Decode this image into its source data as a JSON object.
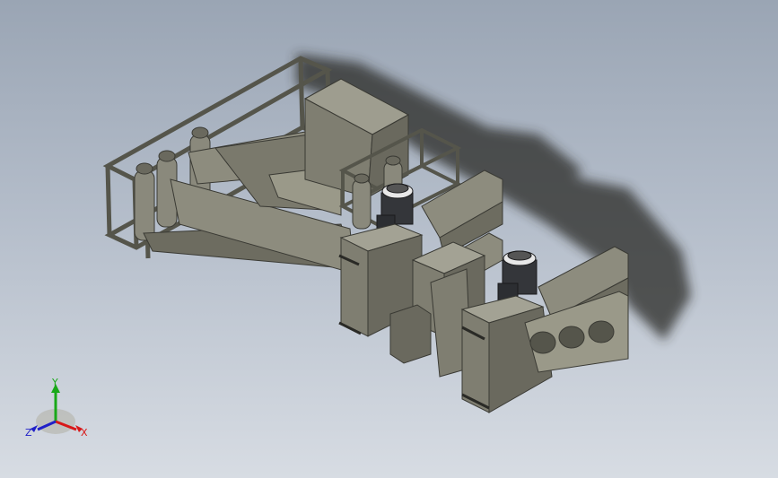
{
  "viewport": {
    "background_top": "#9aa5b4",
    "background_bottom": "#d7dce3"
  },
  "model": {
    "body_color": "#7c7b6e",
    "body_light": "#a3a294",
    "body_dark": "#55554b",
    "shadow_color": "#2a2a28",
    "motor_color": "#34363a"
  },
  "triad": {
    "y_label": "Y",
    "x_label": "X",
    "z_label": "Z",
    "y_color": "#18a818",
    "x_color": "#d81818",
    "z_color": "#2020c8"
  }
}
